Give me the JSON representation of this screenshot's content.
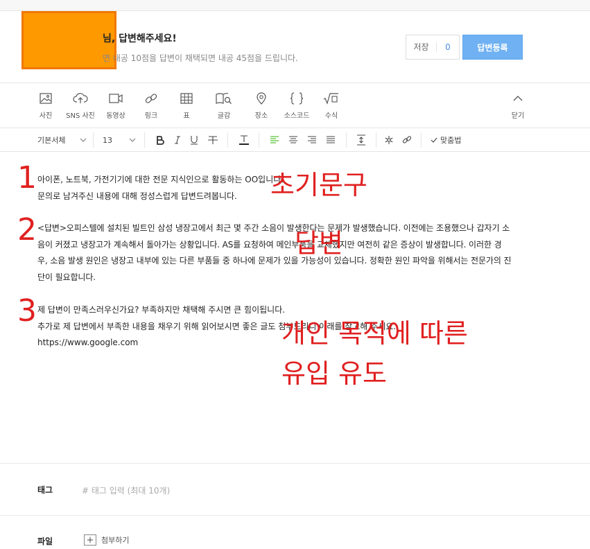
{
  "header": {
    "title": "님, 답변해주세요!",
    "subtitle": "면 내공 10점을 답변이 채택되면 내공 45점을 드립니다.",
    "save_label": "저장",
    "save_count": "0",
    "submit_label": "답변등록"
  },
  "toolbar": {
    "items": [
      {
        "label": "사진",
        "icon": "photo-icon"
      },
      {
        "label": "SNS 사진",
        "icon": "cloud-upload-icon"
      },
      {
        "label": "동영상",
        "icon": "video-icon"
      },
      {
        "label": "링크",
        "icon": "link-icon"
      },
      {
        "label": "표",
        "icon": "table-icon"
      },
      {
        "label": "글감",
        "icon": "book-search-icon"
      },
      {
        "label": "장소",
        "icon": "location-pin-icon"
      },
      {
        "label": "소스코드",
        "icon": "code-braces-icon"
      },
      {
        "label": "수식",
        "icon": "formula-icon"
      }
    ],
    "close_label": "닫기"
  },
  "format": {
    "font_family": "기본서체",
    "font_size": "13",
    "spellcheck_label": "맞춤법"
  },
  "editor": {
    "intro_line1": "아이폰, 노트북, 가전기기에 대한 전문 지식인으로 활동하는 OO입니다.",
    "intro_line2": "문의로 남겨주신 내용에 대해 정성스럽게 답변드려봅니다.",
    "answer_line1": "<답변>오피스텔에 설치된 빌트인 삼성 냉장고에서 최근 몇 주간 소음이 발생한다는 문제가 발생했습니다. 이전에는 조용했으나 갑자기 소",
    "answer_line2": "음이 커졌고 냉장고가 계속해서 돌아가는 상황입니다. AS를 요청하여 메인부품을 교체했지만 여전히 같은 증상이 발생합니다. 이러한 경",
    "answer_line3": "우, 소음 발생 원인은 냉장고 내부에 있는 다른 부품들 중 하나에 문제가 있을 가능성이 있습니다. 정확한 원인 파악을 위해서는 전문가의 진",
    "answer_line4": "단이 필요합니다.",
    "closing_line1": "제 답변이 만족스러우신가요? 부족하지만 채택해 주시면 큰 힘이됩니다.",
    "closing_line2": "추가로 제 답변에서 부족한 내용을 채우기 위해 읽어보시면 좋은 글도 첨부드리니 아래를 참고해 주세요.",
    "closing_line3": "https://www.google.com"
  },
  "annotations": {
    "num1": "1",
    "num2": "2",
    "num3": "3",
    "label1": "초기문구",
    "label2": "답변",
    "label3_line1": "개인 목적에 따른",
    "label3_line2": "유입 유도"
  },
  "tags": {
    "label": "태그",
    "placeholder": "# 태그 입력 (최대 10개)"
  },
  "files": {
    "label": "파일",
    "attach_label": "첨부하기"
  },
  "colors": {
    "redaction": "#ff9900",
    "submit": "#6fb1f2",
    "annotation": "#e02020",
    "align_active": "#2db400"
  }
}
